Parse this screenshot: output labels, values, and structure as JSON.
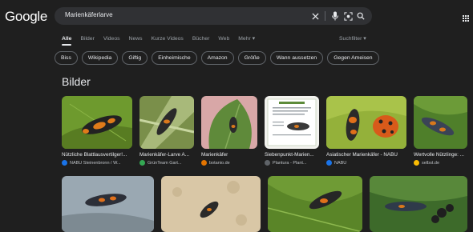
{
  "header": {
    "logo": "Google"
  },
  "search": {
    "query": "Marienkäferlarve"
  },
  "tabs": [
    {
      "label": "Alle"
    },
    {
      "label": "Bilder"
    },
    {
      "label": "Videos"
    },
    {
      "label": "News"
    },
    {
      "label": "Kurze Videos"
    },
    {
      "label": "Bücher"
    },
    {
      "label": "Web"
    },
    {
      "label": "Mehr ▾"
    }
  ],
  "tools": {
    "label": "Suchfilter ▾"
  },
  "chips": [
    "Biss",
    "Wikipedia",
    "Giftig",
    "Einheimische",
    "Amazon",
    "Größe",
    "Wann aussetzen",
    "Gegen Ameisen"
  ],
  "section": {
    "title": "Bilder"
  },
  "colors": {
    "background": "#1f1f1f",
    "searchbox": "#303134",
    "text": "#e8eaed",
    "muted": "#9aa0a6"
  },
  "images": [
    {
      "caption": "Nützliche Blattlausvertilger!...",
      "source": "NABU Steinenbronn / W...",
      "fav_color": "#1a73e8"
    },
    {
      "caption": "Marienkäfer-Larve A...",
      "source": "GrünTeam Gart...",
      "fav_color": "#34a853"
    },
    {
      "caption": "Marienkäfer",
      "source": "botanio.de",
      "fav_color": "#e37400"
    },
    {
      "caption": "Siebenpunkt-Marien...",
      "source": "Plantura - Plant...",
      "fav_color": "#5f6368"
    },
    {
      "caption": "Asiatischer Marienkäfer - NABU",
      "source": "NABU",
      "fav_color": "#1a73e8"
    },
    {
      "caption": "Wertvolle Nützlinge: ...",
      "source": "selbst.de",
      "fav_color": "#fbbc04"
    }
  ]
}
